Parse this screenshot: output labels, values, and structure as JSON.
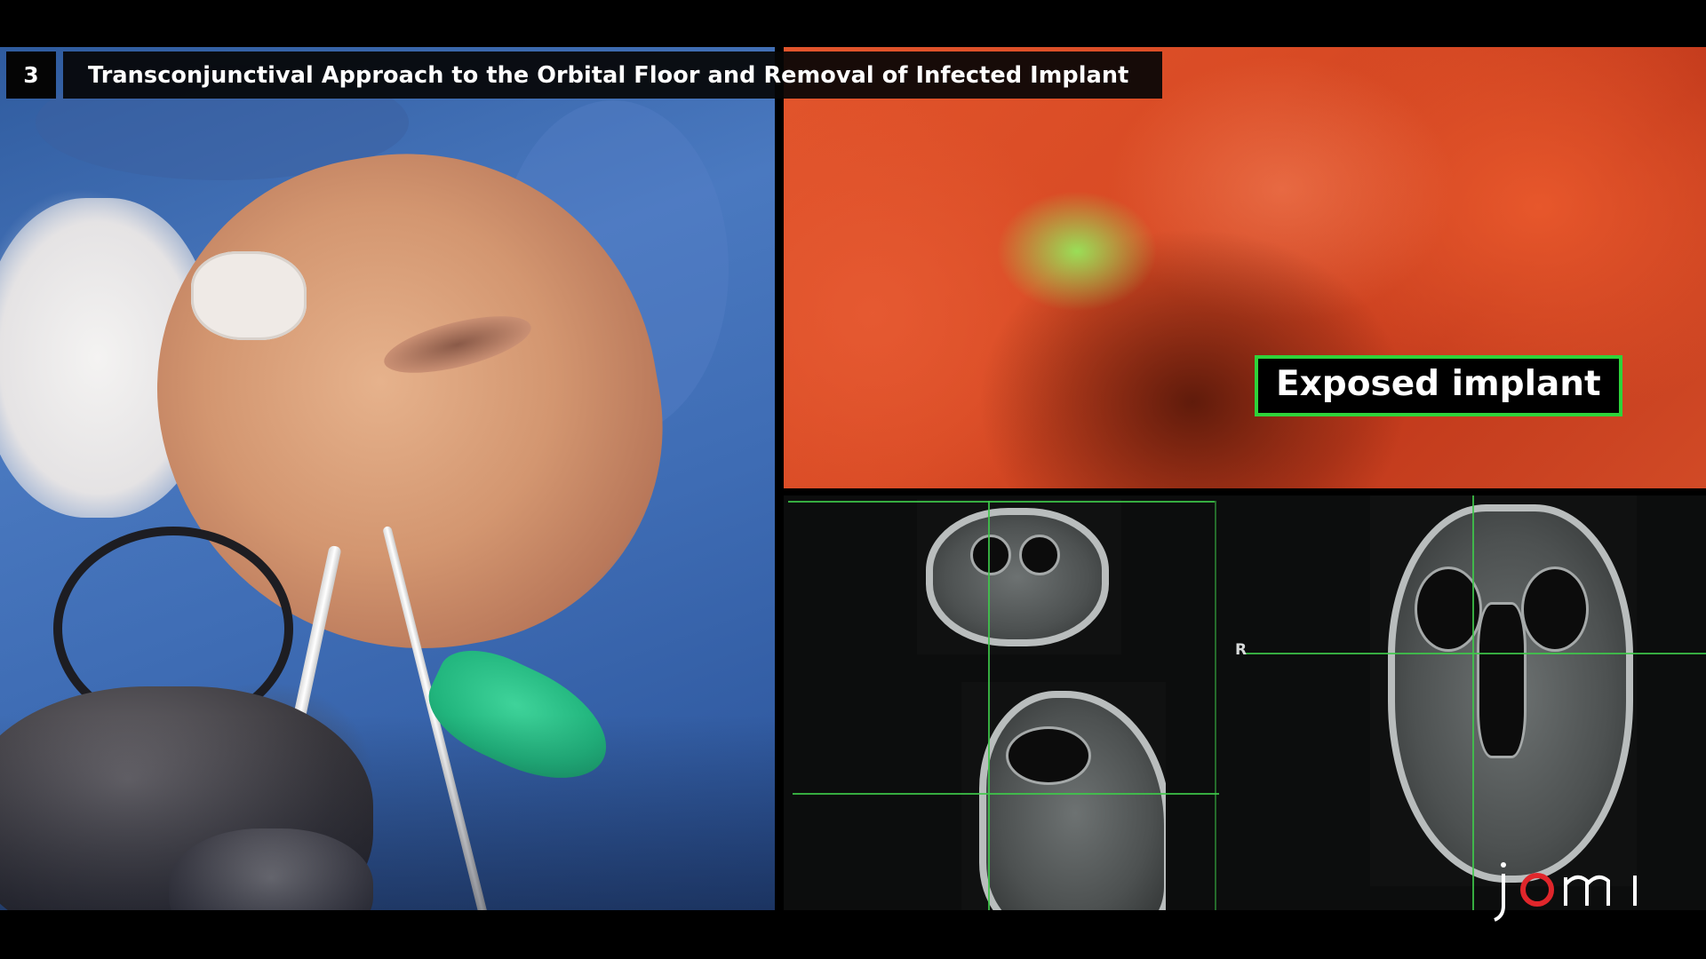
{
  "chapter": {
    "number": "3",
    "title": "Transconjunctival Approach to the Orbital Floor and Removal of Infected Implant"
  },
  "endoscope_view": {
    "label": "Exposed implant",
    "label_border_color": "#2ed33a"
  },
  "ct_view": {
    "orientation_marker": "R",
    "guide_color": "#3ec94a"
  },
  "logo": {
    "text": "jomi",
    "accent_color": "#e0262b"
  }
}
